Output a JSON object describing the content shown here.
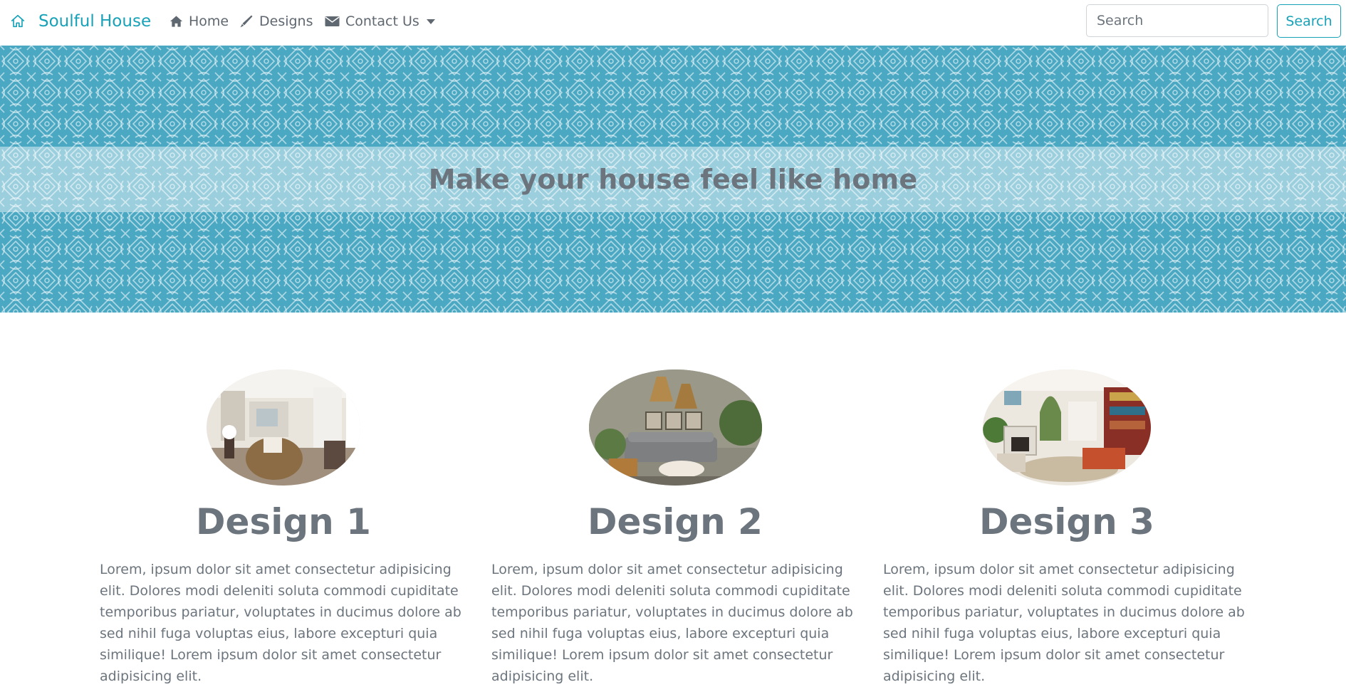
{
  "brand": {
    "icon": "home-outline-icon",
    "name": "Soulful House"
  },
  "nav": {
    "items": [
      {
        "label": "Home",
        "icon": "home-icon"
      },
      {
        "label": "Designs",
        "icon": "pencil-icon"
      },
      {
        "label": "Contact Us",
        "icon": "envelope-icon"
      }
    ]
  },
  "search": {
    "placeholder": "Search",
    "button_label": "Search"
  },
  "hero": {
    "title": "Make your house feel like home"
  },
  "designs": [
    {
      "title": "Design 1",
      "text": "Lorem, ipsum dolor sit amet consectetur adipisicing elit. Dolores modi deleniti soluta commodi cupiditate temporibus pariatur, voluptates in ducimus dolore ab sed nihil fuga voluptas eius, labore excepturi quia similique! Lorem ipsum dolor sit amet consectetur adipisicing elit."
    },
    {
      "title": "Design 2",
      "text": "Lorem, ipsum dolor sit amet consectetur adipisicing elit. Dolores modi deleniti soluta commodi cupiditate temporibus pariatur, voluptates in ducimus dolore ab sed nihil fuga voluptas eius, labore excepturi quia similique! Lorem ipsum dolor sit amet consectetur adipisicing elit."
    },
    {
      "title": "Design 3",
      "text": "Lorem, ipsum dolor sit amet consectetur adipisicing elit. Dolores modi deleniti soluta commodi cupiditate temporibus pariatur, voluptates in ducimus dolore ab sed nihil fuga voluptas eius, labore excepturi quia similique! Lorem ipsum dolor sit amet consectetur adipisicing elit."
    }
  ],
  "colors": {
    "brand": "#17a2b8",
    "hero_background": "#4aa8c3",
    "text": "#6c757d"
  }
}
